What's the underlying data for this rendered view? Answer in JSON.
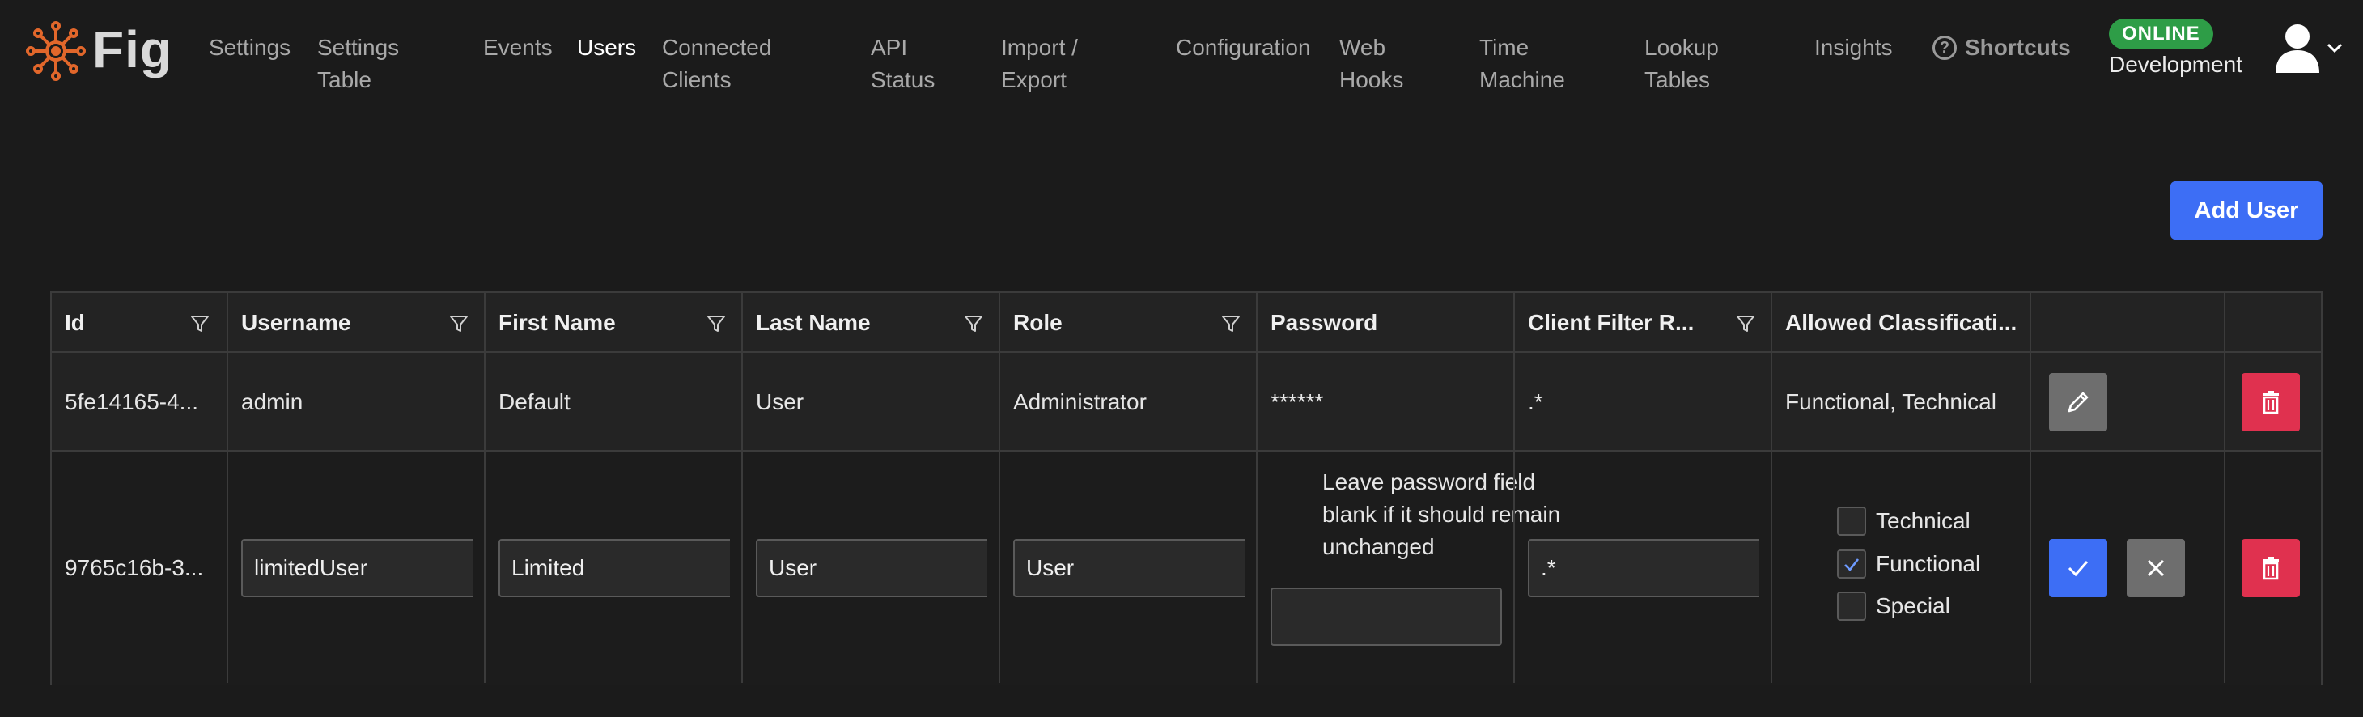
{
  "app": {
    "name": "Fig"
  },
  "nav": {
    "items": [
      {
        "label": "Settings"
      },
      {
        "label": "Settings\nTable"
      },
      {
        "label": "Events"
      },
      {
        "label": "Users"
      },
      {
        "label": "Connected\nClients"
      },
      {
        "label": "API\nStatus"
      },
      {
        "label": "Import /\nExport"
      },
      {
        "label": "Configuration"
      },
      {
        "label": "Web\nHooks"
      },
      {
        "label": "Time\nMachine"
      },
      {
        "label": "Lookup\nTables"
      },
      {
        "label": "Insights"
      }
    ],
    "active": "Users",
    "shortcuts": {
      "icon": "question-circle-icon",
      "label": "Shortcuts"
    },
    "status_badge": "ONLINE",
    "environment": "Development",
    "user_icon": "user-avatar-icon"
  },
  "actions": {
    "add_user": "Add User"
  },
  "table": {
    "columns": [
      {
        "label": "Id",
        "filter": true
      },
      {
        "label": "Username",
        "filter": true
      },
      {
        "label": "First Name",
        "filter": true
      },
      {
        "label": "Last Name",
        "filter": true
      },
      {
        "label": "Role",
        "filter": true
      },
      {
        "label": "Password",
        "filter": false
      },
      {
        "label": "Client Filter R...",
        "filter": true
      },
      {
        "label": "Allowed Classificati...",
        "filter": false
      },
      {
        "label": "",
        "filter": false
      },
      {
        "label": "",
        "filter": false
      }
    ],
    "rows": [
      {
        "id": "5fe14165-4...",
        "username": "admin",
        "first_name": "Default",
        "last_name": "User",
        "role": "Administrator",
        "password": "******",
        "client_filter": ".*",
        "classifications": "Functional, Technical",
        "mode": "view"
      },
      {
        "id": "9765c16b-3...",
        "username": "limitedUser",
        "first_name": "Limited",
        "last_name": "User",
        "role": "User",
        "password_note": "Leave password field blank if it should remain unchanged",
        "password_value": "",
        "client_filter": ".*",
        "classification_options": [
          {
            "label": "Technical",
            "checked": false
          },
          {
            "label": "Functional",
            "checked": true
          },
          {
            "label": "Special",
            "checked": false
          }
        ],
        "mode": "edit"
      }
    ]
  },
  "colors": {
    "background": "#1b1b1b",
    "accent": "#3d6ef5",
    "danger": "#e0314f",
    "online": "#2e9d47",
    "logo": "#e2672b"
  }
}
